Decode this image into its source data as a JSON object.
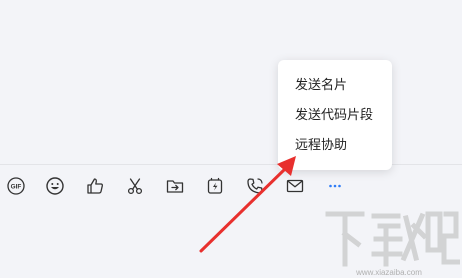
{
  "context_menu": {
    "items": [
      {
        "label": "发送名片"
      },
      {
        "label": "发送代码片段"
      },
      {
        "label": "远程协助"
      }
    ]
  },
  "toolbar": {
    "icons": [
      "gif-icon",
      "emoji-icon",
      "thumbs-up-icon",
      "scissors-icon",
      "folder-send-icon",
      "flash-icon",
      "phone-icon",
      "mail-icon",
      "more-icon"
    ]
  },
  "watermark": {
    "text": "下载吧",
    "domain": "www.xiazaiba.com"
  },
  "colors": {
    "accent": "#2e7cf6",
    "arrow": "#e8302e",
    "icon": "#333333",
    "background": "#f3f4f8"
  }
}
